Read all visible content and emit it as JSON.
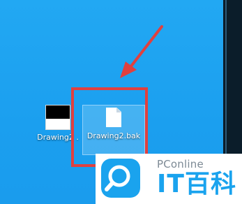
{
  "desktop": {
    "icons": [
      {
        "label": "Drawing2 ."
      },
      {
        "label": "Drawing2.bak"
      }
    ]
  },
  "watermark": {
    "brand": "PConline",
    "brand_cn": "IT百科"
  },
  "colors": {
    "desktop_bg": "#1fa3f0",
    "highlight": "#e0403f",
    "brand_blue": "#1aa3ee"
  }
}
